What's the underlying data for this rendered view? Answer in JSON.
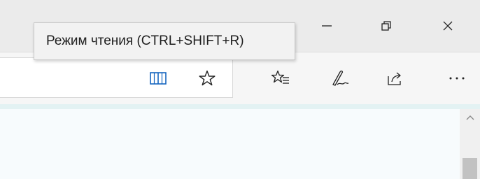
{
  "tooltip": {
    "text": "Режим чтения (CTRL+SHIFT+R)"
  },
  "window_controls": {
    "minimize_icon": "minimize-icon",
    "restore_icon": "restore-icon",
    "close_icon": "close-icon"
  },
  "toolbar": {
    "icons": [
      "reading-view-icon",
      "add-favorite-star-icon",
      "favorites-bar-icon",
      "pen-notes-icon",
      "share-icon",
      "more-icon"
    ],
    "more_label": "···"
  },
  "colors": {
    "titlebar": "#ebebeb",
    "toolbar": "#f6f6f6",
    "reading_view_icon": "#1565c0",
    "content_strip": "#e3f2f3",
    "content": "#f7fbfd"
  }
}
